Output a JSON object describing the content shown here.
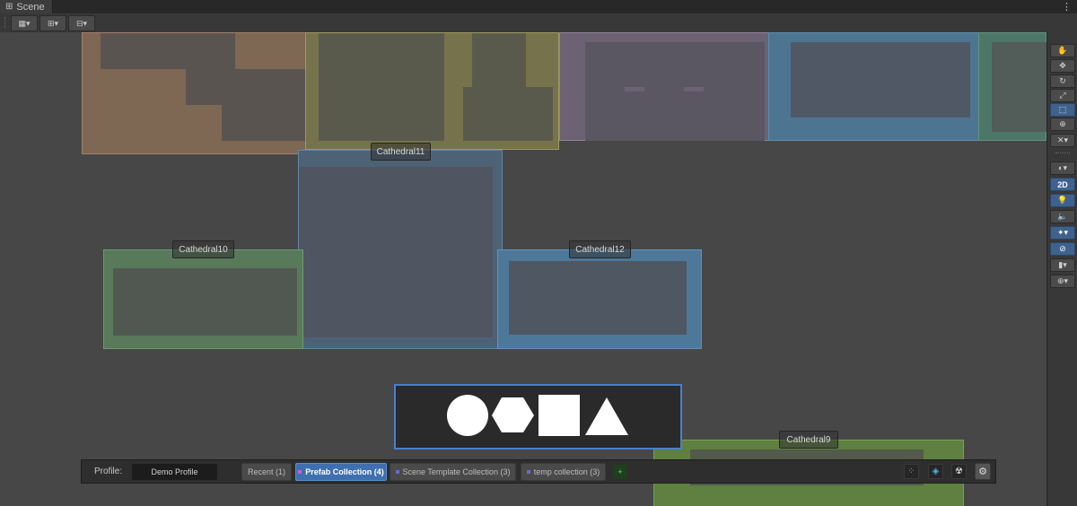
{
  "window": {
    "tab_icon": "grid-icon",
    "title": "Scene",
    "menu_icon": "more-vertical-icon",
    "menu_glyph": "⋮"
  },
  "toolbar": {
    "buttons": [
      {
        "name": "draw-mode-button",
        "glyph": "▦▾"
      },
      {
        "name": "snap-settings-button",
        "glyph": "⊞▾"
      },
      {
        "name": "grid-settings-button",
        "glyph": "⊟▾"
      }
    ]
  },
  "rooms": [
    {
      "name": "Cathedral11",
      "color": "#8a6b54"
    },
    {
      "name": "Cathedral10",
      "color": "#5a7a58"
    },
    {
      "name": "Cathedral12",
      "color": "#4d7a9b"
    },
    {
      "name": "Cathedral9",
      "color": "#62803e"
    }
  ],
  "scene_tools": [
    {
      "name": "hand-tool",
      "glyph": "✋"
    },
    {
      "name": "move-tool",
      "glyph": "✥"
    },
    {
      "name": "rotate-tool",
      "glyph": "↻"
    },
    {
      "name": "scale-tool",
      "glyph": "⤢"
    },
    {
      "name": "rect-tool",
      "glyph": "⬚"
    },
    {
      "name": "transform-tool",
      "glyph": "⊕"
    },
    {
      "name": "custom-tool",
      "glyph": "✕▾"
    }
  ],
  "view_options": [
    {
      "name": "shading-mode",
      "glyph": "◐▾"
    },
    {
      "name": "2d-toggle",
      "glyph": "2D"
    },
    {
      "name": "lighting-toggle",
      "glyph": "💡"
    },
    {
      "name": "audio-toggle",
      "glyph": "🔈"
    },
    {
      "name": "effects-toggle",
      "glyph": "✦▾"
    },
    {
      "name": "hidden-objects-toggle",
      "glyph": "⊘"
    },
    {
      "name": "camera-settings",
      "glyph": "▮▾"
    },
    {
      "name": "gizmos-toggle",
      "glyph": "⊕▾"
    }
  ],
  "preview_shapes": [
    "circle",
    "hexagon",
    "square",
    "triangle"
  ],
  "bottom_bar": {
    "profile_label": "Profile:",
    "profile_value": "Demo Profile",
    "tabs": [
      {
        "label": "Recent (1)",
        "color": ""
      },
      {
        "label": "Prefab Collection (4)",
        "color": "#c060e0"
      },
      {
        "label": "Scene Template Collection (3)",
        "color": "#6a6ad0"
      },
      {
        "label": "temp collection (3)",
        "color": "#6a6ad0"
      }
    ],
    "add_label": "+",
    "icons": [
      {
        "name": "grid-dots-icon",
        "glyph": "⁘",
        "color": "#b37cf0"
      },
      {
        "name": "cube-icon",
        "glyph": "◈",
        "color": "#4fb0f0"
      },
      {
        "name": "radiation-icon",
        "glyph": "☢",
        "color": "#e0e0e0"
      }
    ],
    "settings_icon": "⚙"
  }
}
